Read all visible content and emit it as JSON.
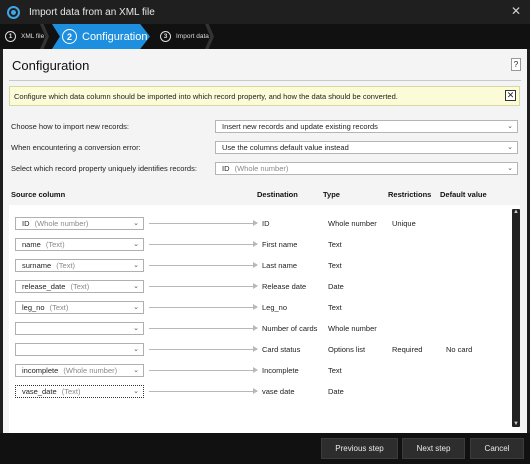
{
  "window": {
    "title": "Import data from an XML file",
    "close_glyph": "✕"
  },
  "wizard": {
    "steps": [
      {
        "number": "1",
        "label": "XML file"
      },
      {
        "number": "2",
        "label": "Configuration"
      },
      {
        "number": "3",
        "label": "Import data"
      }
    ],
    "active_color": "#1e8fde"
  },
  "page": {
    "title": "Configuration",
    "help_label": "?",
    "info_text": "Configure which data column should be imported into which record property, and how the data should be converted.",
    "info_close": "✕"
  },
  "options": [
    {
      "label": "Choose how to import new records:",
      "value": "Insert new records and update existing records",
      "hint": ""
    },
    {
      "label": "When encountering a conversion error:",
      "value": "Use the columns default value instead",
      "hint": ""
    },
    {
      "label": "Select which record property uniquely identifies records:",
      "value": "ID",
      "hint": "(Whole number)"
    }
  ],
  "columns": {
    "source": "Source column",
    "destination": "Destination",
    "type": "Type",
    "restrictions": "Restrictions",
    "default": "Default value"
  },
  "mappings": [
    {
      "source": "ID",
      "source_type": "(Whole number)",
      "destination": "ID",
      "type": "Whole number",
      "restrictions": "Unique",
      "default": ""
    },
    {
      "source": "name",
      "source_type": "(Text)",
      "destination": "First name",
      "type": "Text",
      "restrictions": "",
      "default": ""
    },
    {
      "source": "surname",
      "source_type": "(Text)",
      "destination": "Last name",
      "type": "Text",
      "restrictions": "",
      "default": ""
    },
    {
      "source": "release_date",
      "source_type": "(Text)",
      "destination": "Release date",
      "type": "Date",
      "restrictions": "",
      "default": ""
    },
    {
      "source": "leg_no",
      "source_type": "(Text)",
      "destination": "Leg_no",
      "type": "Text",
      "restrictions": "",
      "default": ""
    },
    {
      "source": "",
      "source_type": "",
      "destination": "Number of cards",
      "type": "Whole number",
      "restrictions": "",
      "default": ""
    },
    {
      "source": "",
      "source_type": "",
      "destination": "Card status",
      "type": "Options list",
      "restrictions": "Required",
      "default": "No card"
    },
    {
      "source": "incomplete",
      "source_type": "(Whole number)",
      "destination": "Incomplete",
      "type": "Text",
      "restrictions": "",
      "default": ""
    },
    {
      "source": "vase_date",
      "source_type": "(Text)",
      "destination": "vase date",
      "type": "Date",
      "restrictions": "",
      "default": ""
    }
  ],
  "footer": {
    "previous": "Previous step",
    "next": "Next step",
    "cancel": "Cancel"
  },
  "icons": {
    "dropdown": "chevron-down-icon",
    "app": "app-logo-icon",
    "scroll_up": "▲",
    "scroll_down": "▼",
    "caret": "⌄"
  }
}
